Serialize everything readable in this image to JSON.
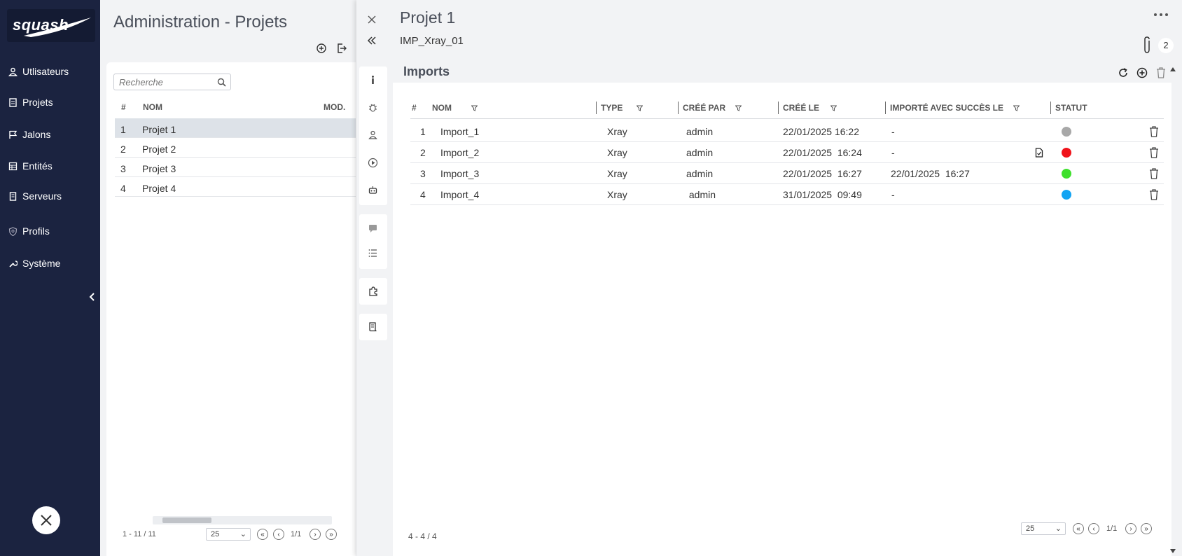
{
  "sidebar": {
    "logo": "squash",
    "items": [
      {
        "label": "Utlisateurs",
        "icon": "user-icon"
      },
      {
        "label": "Projets",
        "icon": "document-icon"
      },
      {
        "label": "Jalons",
        "icon": "flag-icon"
      },
      {
        "label": "Entités",
        "icon": "table-icon"
      },
      {
        "label": "Serveurs",
        "icon": "server-icon"
      },
      {
        "label": "Profils",
        "icon": "shield-icon"
      },
      {
        "label": "Système",
        "icon": "wrench-icon"
      }
    ]
  },
  "left_panel": {
    "title": "Administration - Projets",
    "search_placeholder": "Recherche",
    "columns": [
      "#",
      "NOM",
      "MOD."
    ],
    "rows": [
      {
        "num": "1",
        "name": "Projet 1",
        "selected": true
      },
      {
        "num": "2",
        "name": "Projet 2"
      },
      {
        "num": "3",
        "name": "Projet 3"
      },
      {
        "num": "4",
        "name": "Projet 4"
      }
    ],
    "pagination": {
      "range": "1 - 11 / 11",
      "page_size": "25",
      "page": "1/1"
    }
  },
  "detail": {
    "title": "Projet 1",
    "subtitle": "IMP_Xray_01",
    "attachments_count": "2",
    "section_title": "Imports",
    "columns": [
      "#",
      "NOM",
      "TYPE",
      "CRÉÉ PAR",
      "CRÉÉ LE",
      "IMPORTÉ AVEC SUCCÈS LE",
      "STATUT"
    ],
    "rows": [
      {
        "num": "1",
        "name": "Import_1",
        "type": "Xray",
        "created_by": "admin",
        "created_on": "22/01/2025 16:22",
        "imported_on": "-",
        "status_color": "#a8a8a8",
        "has_report": false
      },
      {
        "num": "2",
        "name": "Import_2",
        "type": "Xray",
        "created_by": "admin",
        "created_on": "22/01/2025  16:24",
        "imported_on": "-",
        "status_color": "#f0131b",
        "has_report": true
      },
      {
        "num": "3",
        "name": "Import_3",
        "type": "Xray",
        "created_by": "admin",
        "created_on": "22/01/2025  16:27",
        "imported_on": "22/01/2025  16:27",
        "status_color": "#3ee02c",
        "has_report": false
      },
      {
        "num": "4",
        "name": "Import_4",
        "type": "Xray",
        "created_by": " admin",
        "created_on": "31/01/2025  09:49",
        "imported_on": "-",
        "status_color": "#12a4f3",
        "has_report": false
      }
    ],
    "pagination": {
      "range": "4 - 4 / 4",
      "page_size": "25",
      "page": "1/1"
    }
  }
}
